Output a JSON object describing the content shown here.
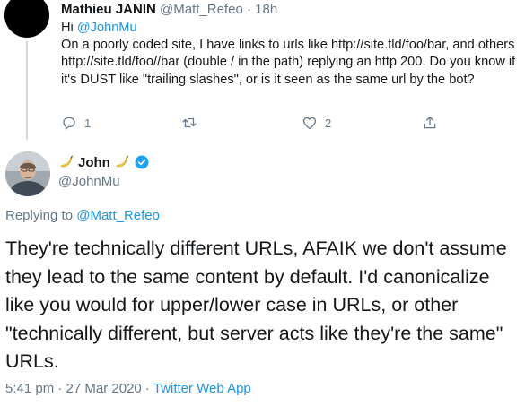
{
  "parent_tweet": {
    "author_name": "Mathieu JANIN",
    "handle": "@Matt_Refeo",
    "separator": "·",
    "time": "18h",
    "text_prefix": "Hi ",
    "mention": "@JohnMu",
    "text_body": "On a poorly coded site, I have links to urls like http://site.tld/foo/bar, and others http://site.tld/foo//bar (double / in the path) replying an http 200. Do you know if it's DUST like \"trailing slashes\", or is it seen as the same url by the bot?",
    "reply_count": "1",
    "retweet_count": "",
    "like_count": "2"
  },
  "main_tweet": {
    "author_name": "John",
    "handle": "@JohnMu",
    "replying_prefix": "Replying to ",
    "replying_to": "@Matt_Refeo",
    "text": "They're technically different URLs, AFAIK we don't assume they lead to the same content by default. I'd canonicalize like you would for upper/lower case in URLs, or other \"technically different, but server acts like they're the same\" URLs.",
    "timestamp": "5:41 pm · 27 Mar 2020 · ",
    "source": "Twitter Web App"
  },
  "colors": {
    "link": "#1b95e0",
    "secondary_text": "#657786",
    "verified": "#1da1f2"
  }
}
